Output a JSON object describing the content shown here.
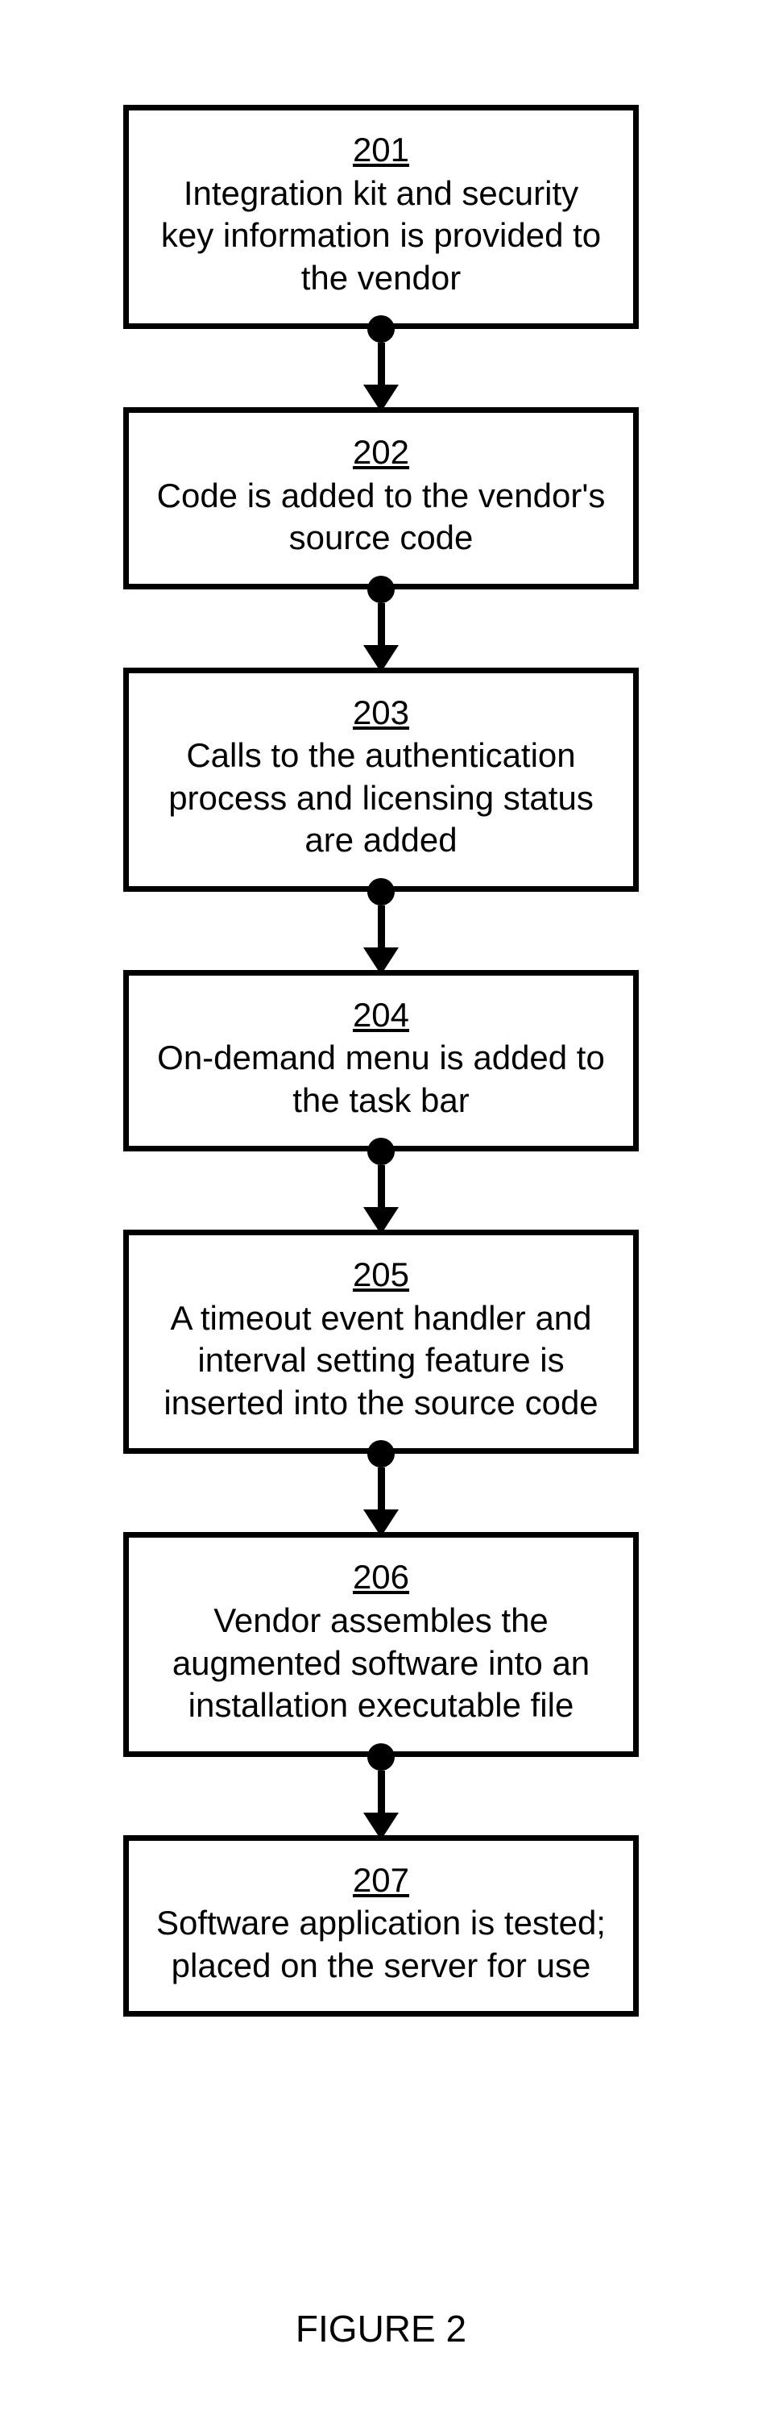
{
  "figure_label": "FIGURE 2",
  "steps": [
    {
      "num": "201",
      "text": "Integration kit and security key information is provided to the vendor"
    },
    {
      "num": "202",
      "text": "Code is added to the vendor's source code"
    },
    {
      "num": "203",
      "text": "Calls to the authentication process and licensing status are added"
    },
    {
      "num": "204",
      "text": "On-demand menu is added to the task bar"
    },
    {
      "num": "205",
      "text": "A timeout event handler and interval setting feature is inserted into the source code"
    },
    {
      "num": "206",
      "text": "Vendor assembles the augmented software into an installation executable file"
    },
    {
      "num": "207",
      "text": "Software application is tested; placed on the server for use"
    }
  ]
}
